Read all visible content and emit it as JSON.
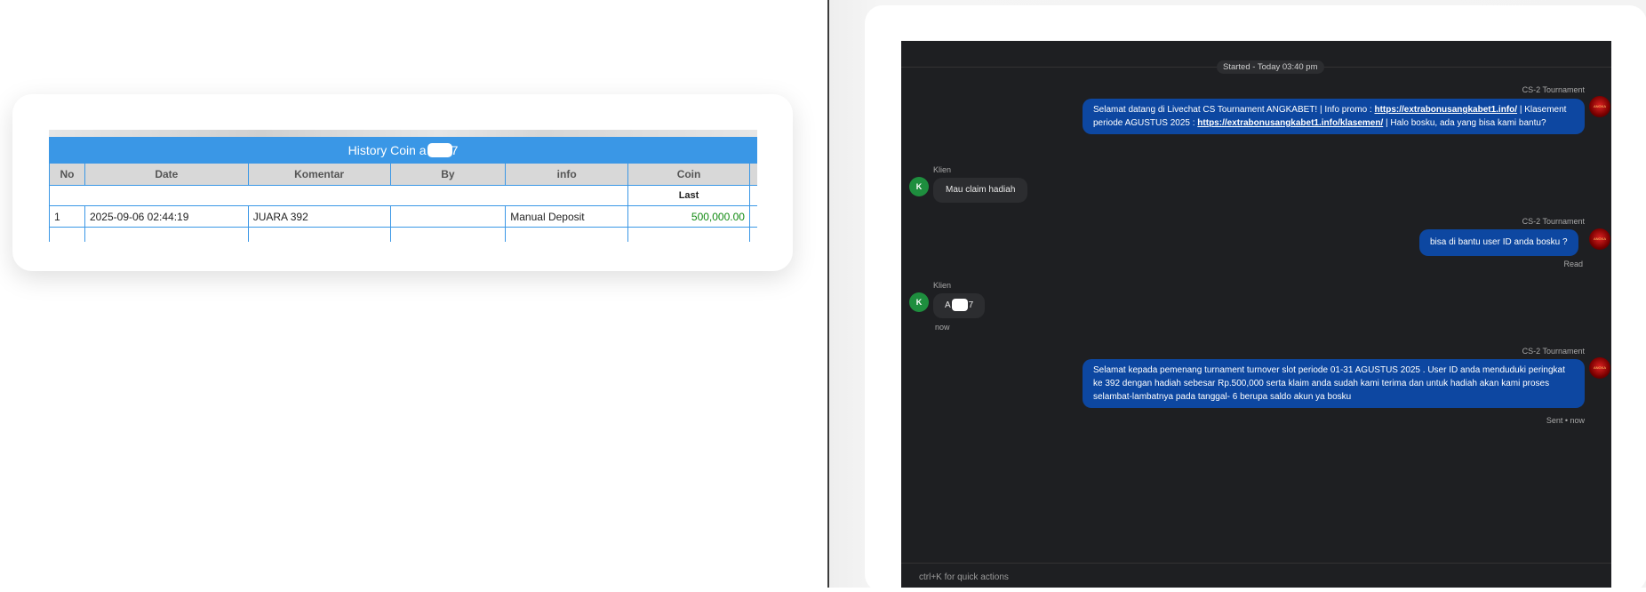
{
  "history_table": {
    "title_prefix": "History Coin a",
    "title_suffix": "7",
    "columns": [
      "No",
      "Date",
      "Komentar",
      "By",
      "info",
      "Coin"
    ],
    "last_label": "Last",
    "rows": [
      {
        "no": "1",
        "date": "2025-09-06 02:44:19",
        "komentar": "JUARA 392",
        "by": "",
        "info": "Manual Deposit",
        "coin": "500,000.00"
      }
    ]
  },
  "chat": {
    "started": "Started - Today 03:40 pm",
    "agent_name": "CS-2 Tournament",
    "client_name": "Klien",
    "client_initial": "K",
    "agent_avatar_text": "ANGKA",
    "messages": [
      {
        "role": "agent",
        "segments": [
          {
            "text": "Selamat datang di Livechat CS Tournament ANGKABET! | Info promo : "
          },
          {
            "text": "https://extrabonusangkabet1.info/",
            "link": true
          },
          {
            "text": " | Klasement periode AGUSTUS 2025 : "
          },
          {
            "text": "https://extrabonusangkabet1.info/klasemen/",
            "link": true
          },
          {
            "text": " | Halo bosku, ada yang bisa kami bantu?"
          }
        ]
      },
      {
        "role": "client",
        "text": "Mau claim hadiah"
      },
      {
        "role": "agent",
        "text": "bisa di bantu user ID anda bosku ?",
        "status": "Read"
      },
      {
        "role": "client",
        "text_prefix": "A",
        "text_suffix": "7",
        "status": "now"
      },
      {
        "role": "agent",
        "text": "Selamat kepada pemenang turnament turnover slot periode 01-31 AGUSTUS 2025 . User ID anda menduduki peringkat ke 392 dengan hadiah sebesar Rp.500,000 serta klaim anda sudah kami terima dan untuk hadiah akan kami proses selambat-lambatnya pada tanggal- 6 berupa saldo akun ya bosku",
        "status": "Sent • now"
      }
    ],
    "quick_actions_hint": "ctrl+K for quick actions"
  },
  "colors": {
    "table_header_blue": "#3a97e6",
    "agent_bubble": "#0d47a1",
    "chat_bg": "#1e1f22",
    "client_avatar": "#1e8e3e",
    "coin_green": "#118a11"
  }
}
